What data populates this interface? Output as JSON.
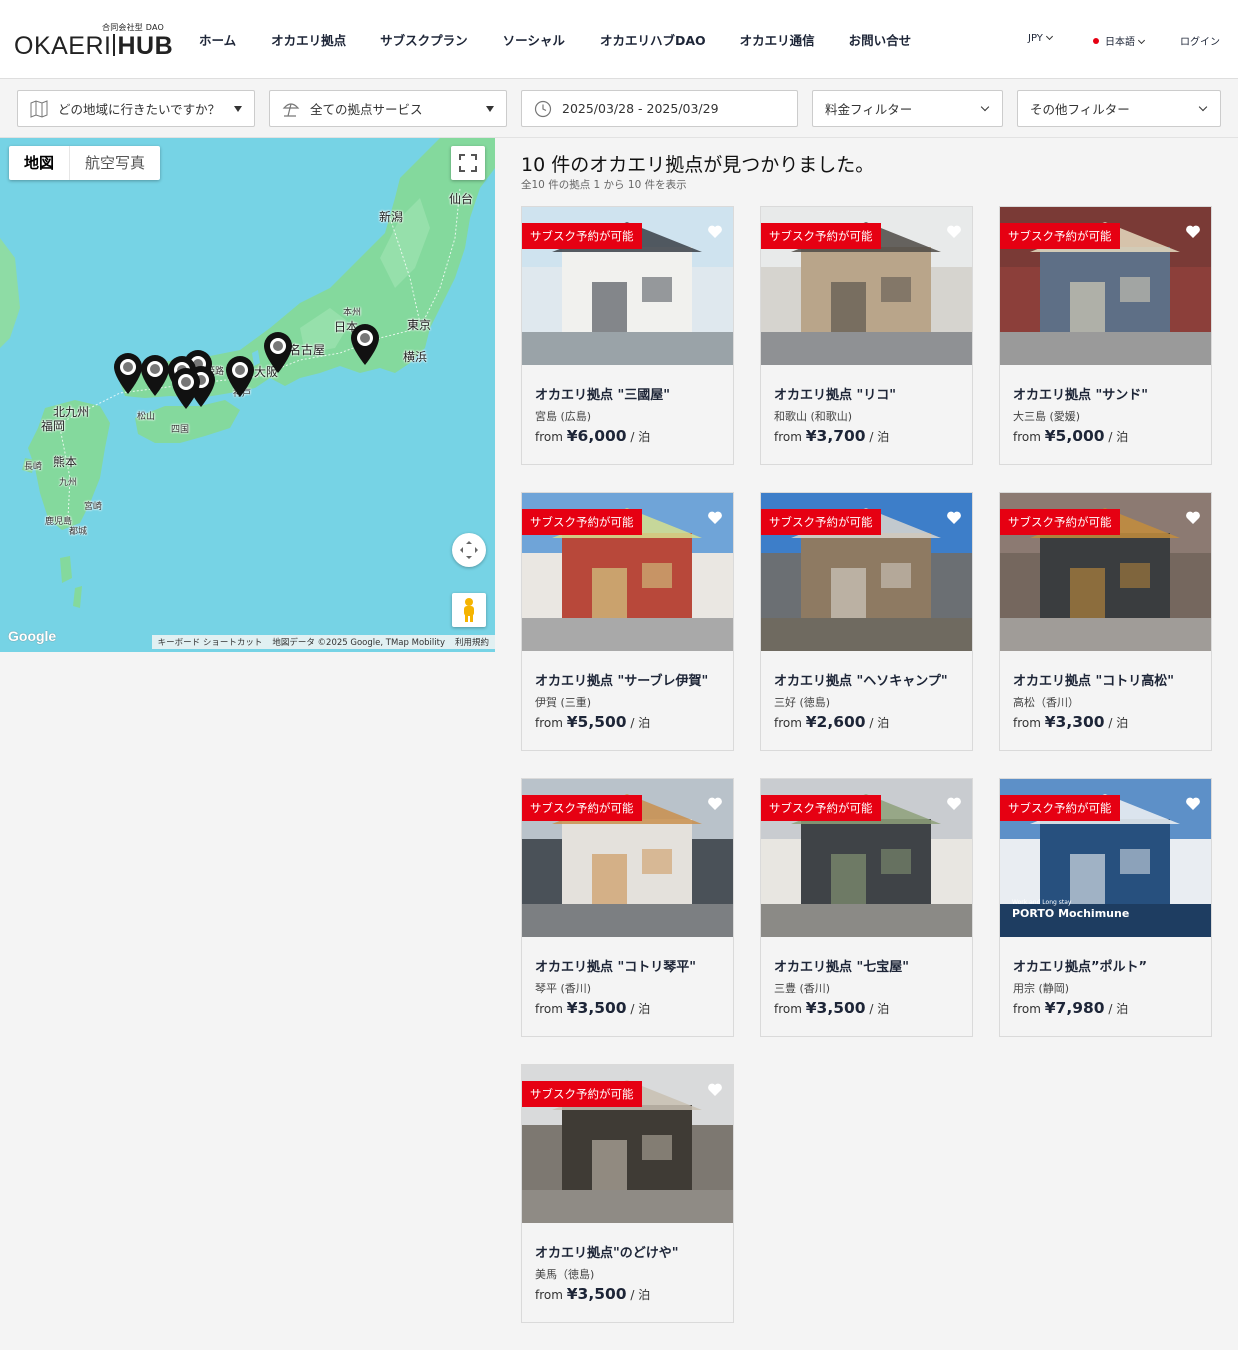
{
  "header": {
    "logo_sub": "合同会社型 DAO",
    "logo_left": "OKAERI",
    "logo_right": "HUB",
    "nav": [
      "ホーム",
      "オカエリ拠点",
      "サブスクプラン",
      "ソーシャル",
      "オカエリハブDAO",
      "オカエリ通信",
      "お問い合せ"
    ],
    "currency": "JPY",
    "language": "日本語",
    "login": "ログイン"
  },
  "filters": {
    "region_placeholder": "どの地域に行きたいですか？",
    "service": "全ての拠点サービス",
    "dates": "2025/03/28 - 2025/03/29",
    "price_filter": "料金フィルター",
    "other_filter": "その他フィルター"
  },
  "map": {
    "toggle_map": "地図",
    "toggle_satellite": "航空写真",
    "cities": [
      "仙台",
      "新潟",
      "本州",
      "日本",
      "東京",
      "横浜",
      "名古屋",
      "大阪",
      "神戸",
      "姫路",
      "北九州",
      "福岡",
      "松山",
      "四国",
      "長崎",
      "熊本",
      "九州",
      "宮崎",
      "鹿児島",
      "都城"
    ],
    "google": "Google",
    "attribution": [
      "キーボード ショートカット",
      "地図データ ©2025 Google, TMap Mobility",
      "利用規約"
    ]
  },
  "results": {
    "title": "10 件のオカエリ拠点が見つかりました。",
    "subtitle": "全10 件の拠点 1 から 10 件を表示",
    "badge": "サブスク予約が可能",
    "from": "from",
    "per_night": "/ 泊",
    "items": [
      {
        "name": "オカエリ拠点 \"三國屋\"",
        "location": "宮島 (広島)",
        "price": "¥6,000"
      },
      {
        "name": "オカエリ拠点 \"リコ\"",
        "location": "和歌山 (和歌山)",
        "price": "¥3,700"
      },
      {
        "name": "オカエリ拠点 \"サンド\"",
        "location": "大三島 (愛媛)",
        "price": "¥5,000"
      },
      {
        "name": "オカエリ拠点 \"サーブレ伊賀\"",
        "location": "伊賀 (三重)",
        "price": "¥5,500"
      },
      {
        "name": "オカエリ拠点 \"ヘソキャンプ\"",
        "location": "三好 (徳島)",
        "price": "¥2,600"
      },
      {
        "name": "オカエリ拠点 \"コトリ高松\"",
        "location": "高松（香川）",
        "price": "¥3,300"
      },
      {
        "name": "オカエリ拠点 \"コトリ琴平\"",
        "location": "琴平 (香川)",
        "price": "¥3,500"
      },
      {
        "name": "オカエリ拠点 \"七宝屋\"",
        "location": "三豊 (香川)",
        "price": "¥3,500"
      },
      {
        "name": "オカエリ拠点”ポルト”",
        "location": "用宗 (静岡)",
        "price": "¥7,980"
      },
      {
        "name": "オカエリ拠点\"のどけや\"",
        "location": "美馬（徳島)",
        "price": "¥3,500"
      }
    ],
    "photo_overlay": [
      "Work and Long stay",
      "PORTO Mochimune"
    ]
  },
  "colors": {
    "accent_red": "#e60012",
    "map_water": "#76d3e5",
    "map_land": "#7fd99b",
    "text_dark": "#1d2537"
  }
}
